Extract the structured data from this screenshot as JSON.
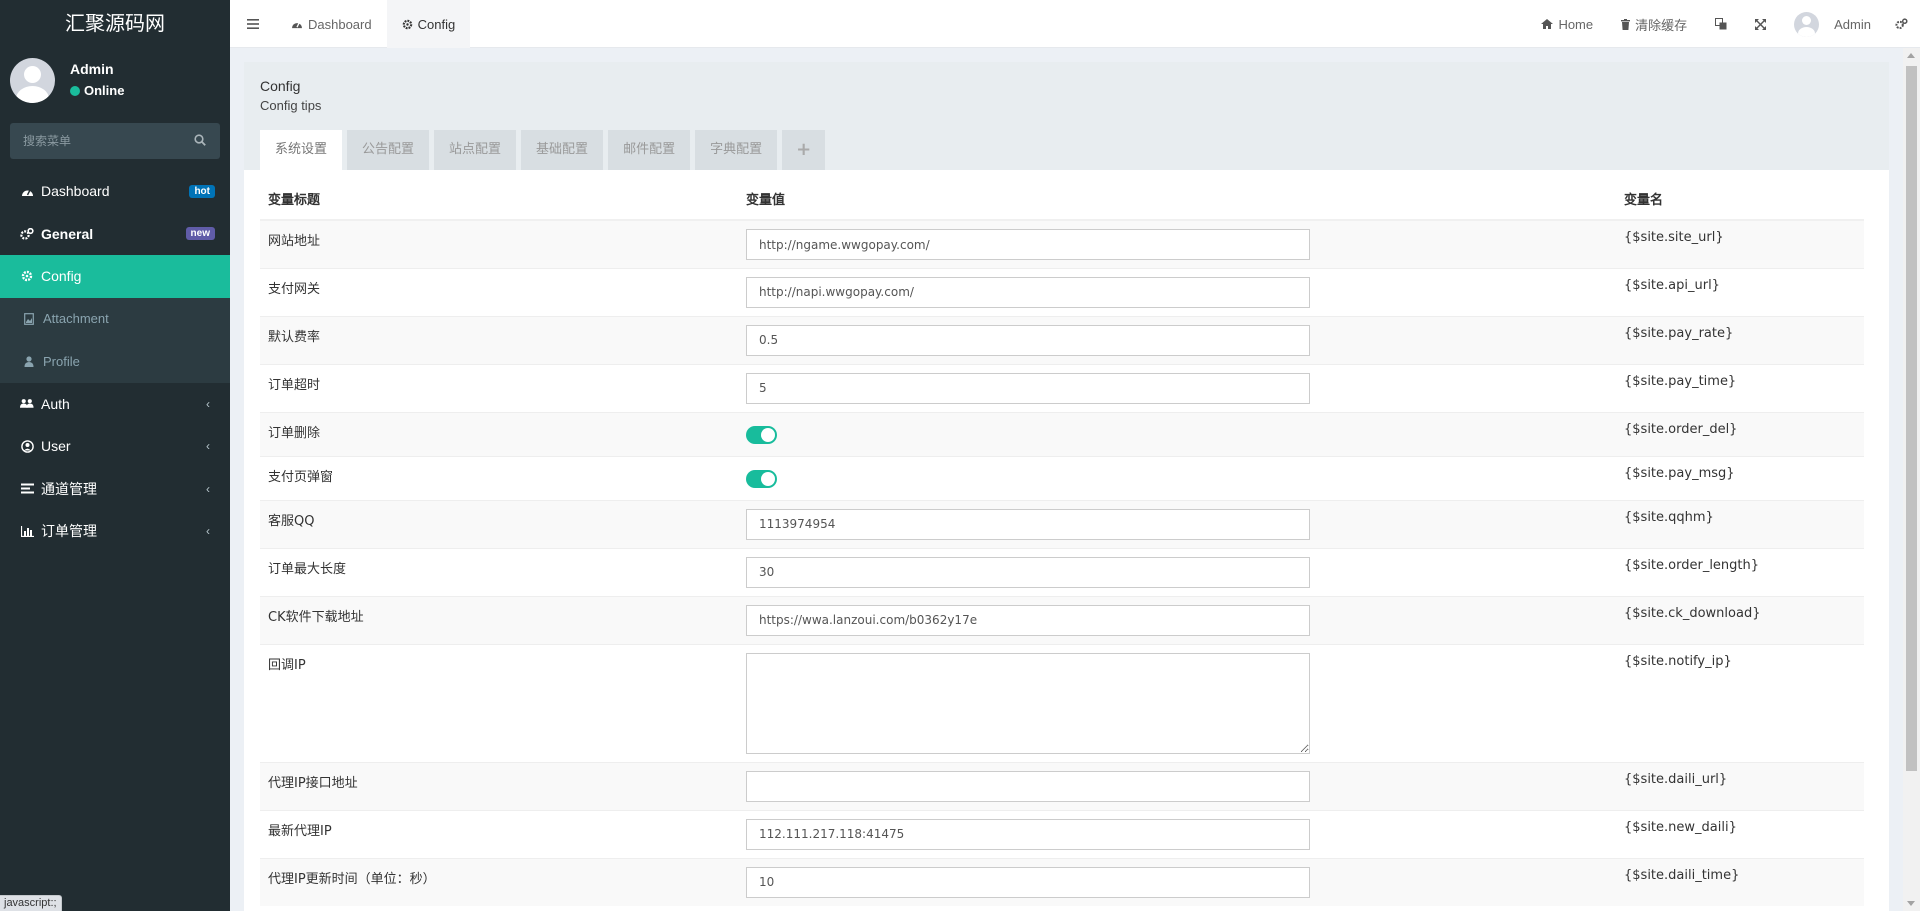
{
  "brand": {
    "title": "汇聚源码网"
  },
  "user": {
    "name": "Admin",
    "status": "Online"
  },
  "sidebar": {
    "search_placeholder": "搜索菜单",
    "items": [
      {
        "label": "Dashboard",
        "icon": "dashboard-icon",
        "badge": "hot"
      },
      {
        "label": "General",
        "icon": "cogs-icon",
        "badge": "new"
      },
      {
        "label": "Config",
        "icon": "gear-icon"
      },
      {
        "label": "Attachment",
        "icon": "file-image-icon"
      },
      {
        "label": "Profile",
        "icon": "user-icon"
      },
      {
        "label": "Auth",
        "icon": "group-icon"
      },
      {
        "label": "User",
        "icon": "user-circle-icon"
      },
      {
        "label": "通道管理",
        "icon": "list-icon"
      },
      {
        "label": "订单管理",
        "icon": "bar-chart-icon"
      }
    ]
  },
  "navbar": {
    "tabs": [
      {
        "label": "Dashboard",
        "icon": "dashboard-icon"
      },
      {
        "label": "Config",
        "icon": "gear-icon"
      }
    ],
    "right": {
      "home": "Home",
      "clear_cache": "清除缓存",
      "user": "Admin"
    }
  },
  "panel": {
    "title": "Config",
    "tips": "Config tips",
    "tabs": [
      "系统设置",
      "公告配置",
      "站点配置",
      "基础配置",
      "邮件配置",
      "字典配置",
      "+"
    ]
  },
  "table": {
    "headers": [
      "变量标题",
      "变量值",
      "变量名"
    ],
    "rows": [
      {
        "label": "网站地址",
        "type": "input",
        "value": "http://ngame.wwgopay.com/",
        "var": "{$site.site_url}"
      },
      {
        "label": "支付网关",
        "type": "input",
        "value": "http://napi.wwgopay.com/",
        "var": "{$site.api_url}"
      },
      {
        "label": "默认费率",
        "type": "input",
        "value": "0.5",
        "var": "{$site.pay_rate}"
      },
      {
        "label": "订单超时",
        "type": "input",
        "value": "5",
        "var": "{$site.pay_time}"
      },
      {
        "label": "订单删除",
        "type": "toggle",
        "value": "on",
        "var": "{$site.order_del}"
      },
      {
        "label": "支付页弹窗",
        "type": "toggle",
        "value": "on",
        "var": "{$site.pay_msg}"
      },
      {
        "label": "客服QQ",
        "type": "input",
        "value": "1113974954",
        "var": "{$site.qqhm}"
      },
      {
        "label": "订单最大长度",
        "type": "input",
        "value": "30",
        "var": "{$site.order_length}"
      },
      {
        "label": "CK软件下载地址",
        "type": "input",
        "value": "https://wwa.lanzoui.com/b0362y17e",
        "var": "{$site.ck_download}"
      },
      {
        "label": "回调IP",
        "type": "textarea",
        "value": "",
        "var": "{$site.notify_ip}"
      },
      {
        "label": "代理IP接口地址",
        "type": "input",
        "value": "",
        "var": "{$site.daili_url}"
      },
      {
        "label": "最新代理IP",
        "type": "input",
        "value": "112.111.217.118:41475",
        "var": "{$site.new_daili}"
      },
      {
        "label": "代理IP更新时间（单位：秒）",
        "type": "input",
        "value": "10",
        "var": "{$site.daili_time}"
      }
    ]
  },
  "statusbar": {
    "text": "javascript:;"
  },
  "colors": {
    "accent": "#1abc9c",
    "sidebar": "#222d32",
    "badge_hot": "#0073b7",
    "badge_new": "#605ca8"
  }
}
